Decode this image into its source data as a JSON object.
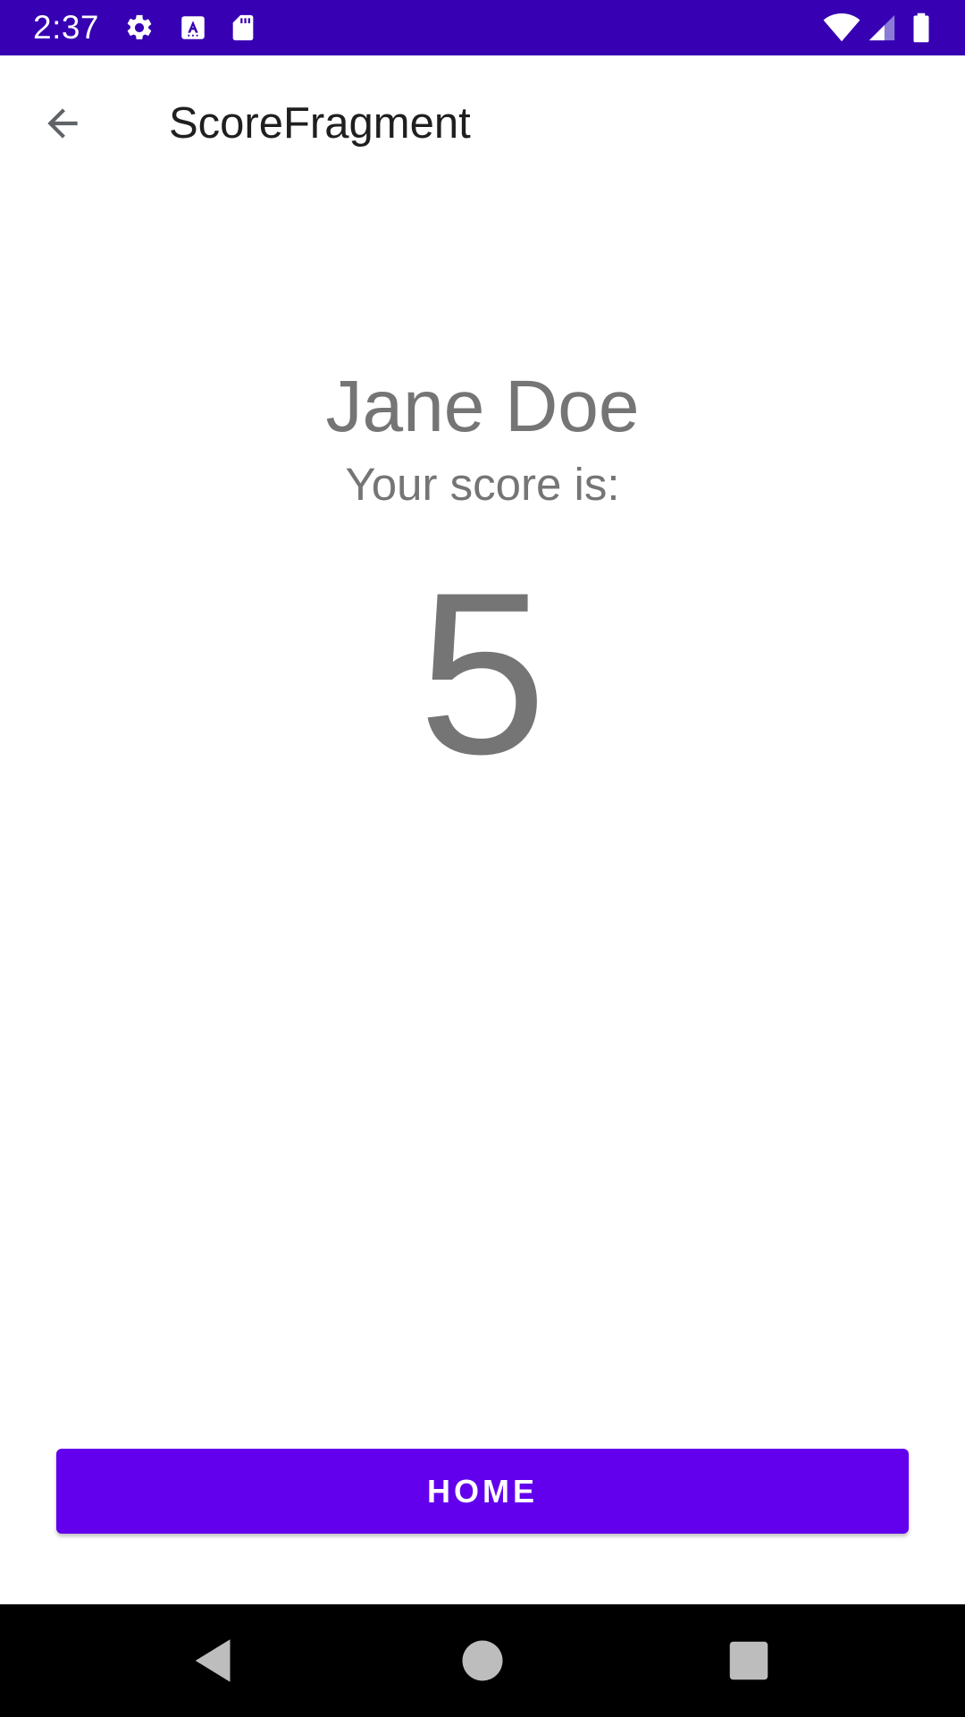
{
  "status_bar": {
    "time": "2:37",
    "background_color": "#3700b3",
    "icons": [
      "settings-icon",
      "text-a-icon",
      "sd-card-icon",
      "wifi-icon",
      "cell-signal-icon",
      "battery-icon"
    ]
  },
  "app_bar": {
    "title": "ScoreFragment",
    "back_icon": "arrow-back-icon"
  },
  "score": {
    "player_name": "Jane Doe",
    "label": "Your score is:",
    "value": "5",
    "text_color": "#757575"
  },
  "home_button": {
    "label": "HOME",
    "color": "#6200ee"
  },
  "nav_bar": {
    "icons": [
      "back-triangle-icon",
      "home-circle-icon",
      "recents-square-icon"
    ]
  }
}
